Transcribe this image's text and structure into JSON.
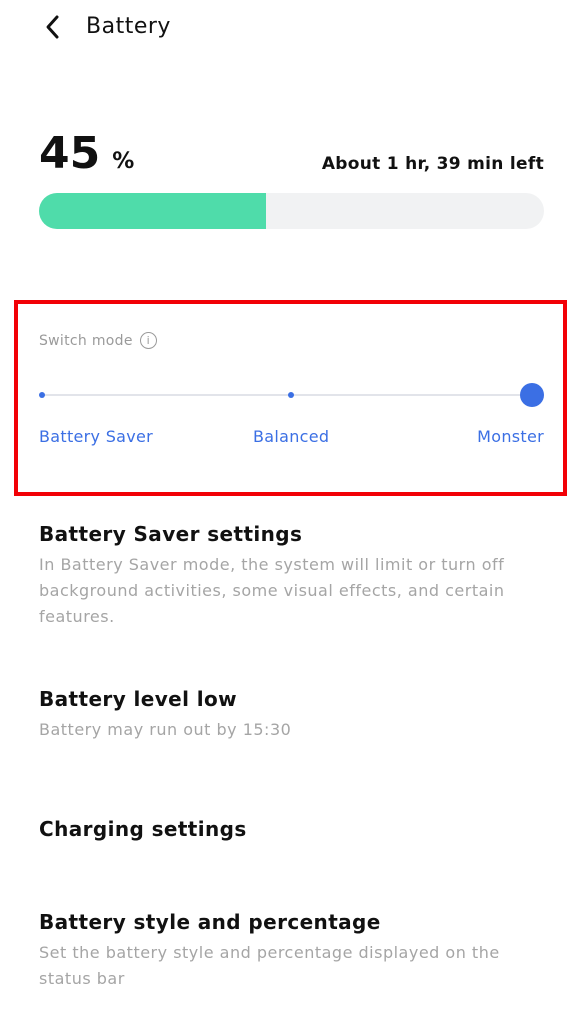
{
  "header": {
    "back_icon": "chevron-left-icon",
    "title": "Battery"
  },
  "battery": {
    "percent": "45",
    "percent_sign": "%",
    "percent_value": 45,
    "time_left": "About 1 hr, 39 min left",
    "fill_color": "#4fdcaa"
  },
  "mode": {
    "label": "Switch mode",
    "info_icon": "info-icon",
    "options": [
      "Battery Saver",
      "Balanced",
      "Monster"
    ],
    "selected": "Monster",
    "accent_color": "#3b6fe4"
  },
  "settings": [
    {
      "title": "Battery Saver settings",
      "description": "In Battery Saver mode, the system will limit or turn off background activities, some visual effects, and certain features."
    },
    {
      "title": "Battery level low",
      "description": "Battery may run out by 15:30"
    },
    {
      "title": "Charging settings",
      "description": ""
    },
    {
      "title": "Battery style and percentage",
      "description": "Set the battery style and percentage displayed on the status bar"
    }
  ]
}
